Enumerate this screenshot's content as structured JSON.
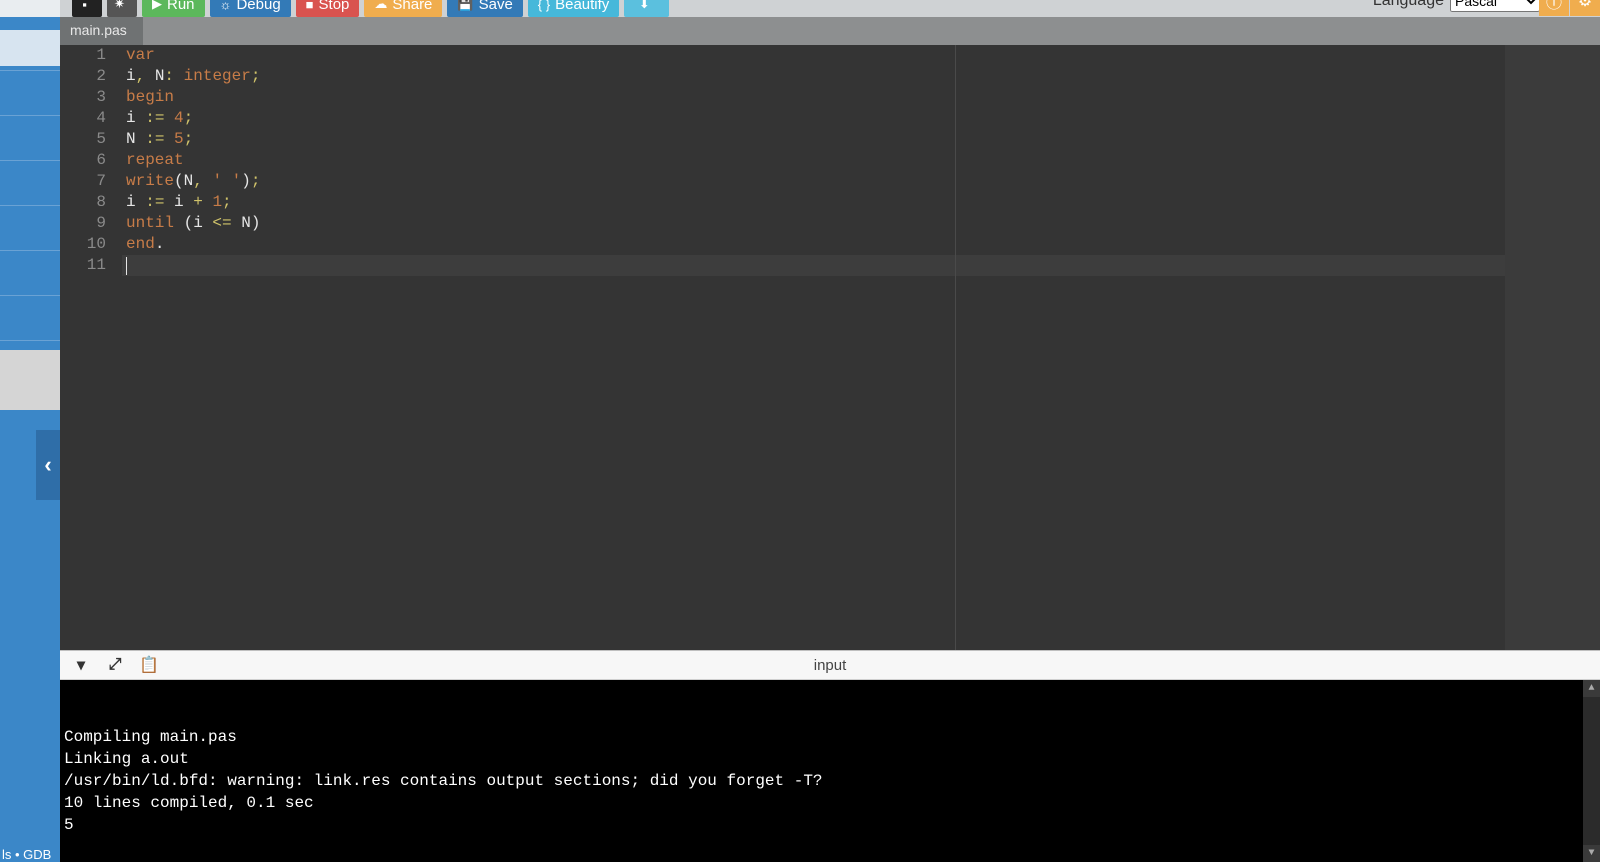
{
  "toolbar": {
    "run_label": "Run",
    "debug_label": "Debug",
    "stop_label": "Stop",
    "share_label": "Share",
    "save_label": "Save",
    "beautify_label": "Beautify",
    "language_label": "Language",
    "language_value": "Pascal"
  },
  "tabs": {
    "file_tab_label": "main.pas"
  },
  "sidebar": {
    "collapse_glyph": "‹",
    "footer_text": "ls • GDB"
  },
  "editor": {
    "line_numbers": [
      "1",
      "2",
      "3",
      "4",
      "5",
      "6",
      "7",
      "8",
      "9",
      "10",
      "11"
    ],
    "code_lines": [
      [
        {
          "t": "var",
          "c": "kw"
        }
      ],
      [
        {
          "t": "i",
          "c": "id"
        },
        {
          "t": ",",
          "c": "punc"
        },
        {
          "t": " N",
          "c": "id"
        },
        {
          "t": ":",
          "c": "punc"
        },
        {
          "t": " integer",
          "c": "kw"
        },
        {
          "t": ";",
          "c": "punc"
        }
      ],
      [
        {
          "t": "begin",
          "c": "kw"
        }
      ],
      [
        {
          "t": "i ",
          "c": "id"
        },
        {
          "t": ":",
          "c": "punc"
        },
        {
          "t": "= ",
          "c": "op"
        },
        {
          "t": "4",
          "c": "num"
        },
        {
          "t": ";",
          "c": "punc"
        }
      ],
      [
        {
          "t": "N ",
          "c": "id"
        },
        {
          "t": ":",
          "c": "punc"
        },
        {
          "t": "= ",
          "c": "op"
        },
        {
          "t": "5",
          "c": "num"
        },
        {
          "t": ";",
          "c": "punc"
        }
      ],
      [
        {
          "t": "repeat",
          "c": "kw"
        }
      ],
      [
        {
          "t": "write",
          "c": "kw"
        },
        {
          "t": "(N",
          "c": "id"
        },
        {
          "t": ",",
          "c": "punc"
        },
        {
          "t": " ",
          "c": "id"
        },
        {
          "t": "' '",
          "c": "str"
        },
        {
          "t": ")",
          "c": "id"
        },
        {
          "t": ";",
          "c": "punc"
        }
      ],
      [
        {
          "t": "i ",
          "c": "id"
        },
        {
          "t": ":",
          "c": "punc"
        },
        {
          "t": "= ",
          "c": "op"
        },
        {
          "t": "i ",
          "c": "id"
        },
        {
          "t": "+",
          "c": "op"
        },
        {
          "t": " ",
          "c": "id"
        },
        {
          "t": "1",
          "c": "num"
        },
        {
          "t": ";",
          "c": "punc"
        }
      ],
      [
        {
          "t": "until",
          "c": "kw"
        },
        {
          "t": " (i ",
          "c": "id"
        },
        {
          "t": "<",
          "c": "op"
        },
        {
          "t": "= ",
          "c": "op"
        },
        {
          "t": "N)",
          "c": "id"
        }
      ],
      [
        {
          "t": "end",
          "c": "kw"
        },
        {
          "t": ".",
          "c": "id"
        }
      ],
      [
        {
          "t": "",
          "c": "id"
        }
      ]
    ],
    "active_line_index": 10
  },
  "panel": {
    "title": "input"
  },
  "console": {
    "lines": [
      "Compiling main.pas",
      "Linking a.out",
      "/usr/bin/ld.bfd: warning: link.res contains output sections; did you forget -T?",
      "10 lines compiled, 0.1 sec",
      "5"
    ]
  }
}
